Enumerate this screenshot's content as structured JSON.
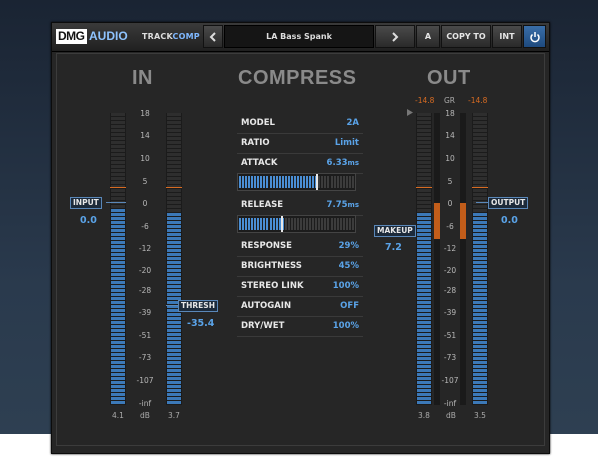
{
  "header": {
    "logo_dmg": "DMG",
    "logo_audio": "AUDIO",
    "product_track": "TRACK",
    "product_comp": "COMP",
    "prev_icon": "chevron-left-icon",
    "next_icon": "chevron-right-icon",
    "preset_name": "LA Bass Spank",
    "ab_label": "A",
    "copy_to_label": "COPY TO",
    "int_label": "INT",
    "power_icon": "power-icon"
  },
  "sections": {
    "in_title": "IN",
    "compress_title": "COMPRESS",
    "out_title": "OUT"
  },
  "scale": [
    "18",
    "14",
    "10",
    "5",
    "0",
    "-6",
    "-12",
    "-20",
    "-28",
    "-39",
    "-51",
    "-73",
    "-107",
    "-inf"
  ],
  "in": {
    "input_label": "INPUT",
    "input_value": "0.0",
    "thresh_label": "THRESH",
    "thresh_value": "-35.4",
    "left_level": "4.1",
    "unit": "dB",
    "right_level": "3.7"
  },
  "out": {
    "peak_left": "-14.8",
    "gr_label": "GR",
    "peak_right": "-14.8",
    "makeup_label": "MAKEUP",
    "makeup_value": "7.2",
    "output_label": "OUTPUT",
    "output_value": "0.0",
    "left_level": "3.8",
    "unit": "dB",
    "right_level": "3.5"
  },
  "params": [
    {
      "label": "MODEL",
      "value": "2A"
    },
    {
      "label": "RATIO",
      "value": "Limit"
    },
    {
      "label": "ATTACK",
      "value": "6.33",
      "unit": "ms"
    },
    {
      "label": "RELEASE",
      "value": "7.75",
      "unit": "ms"
    },
    {
      "label": "RESPONSE",
      "value": "29%"
    },
    {
      "label": "BRIGHTNESS",
      "value": "45%"
    },
    {
      "label": "STEREO LINK",
      "value": "100%"
    },
    {
      "label": "AUTOGAIN",
      "value": "OFF"
    },
    {
      "label": "DRY/WET",
      "value": "100%"
    }
  ],
  "sliders": {
    "attack_fraction": 0.68,
    "release_fraction": 0.37
  },
  "colors": {
    "accent": "#5aa3e8",
    "meter_fill": "#3c79b8",
    "gr_fill": "#c25d1a",
    "peak": "#d76b22"
  }
}
